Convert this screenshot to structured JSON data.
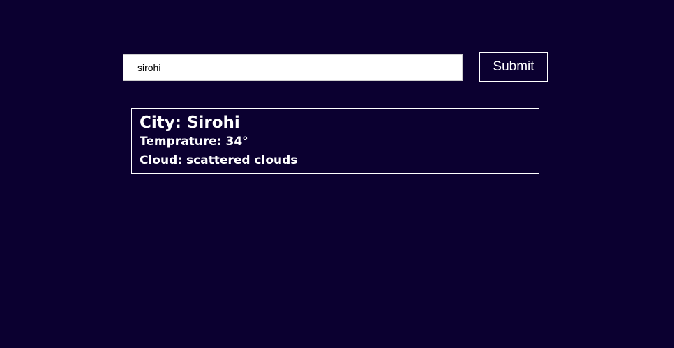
{
  "search": {
    "value": "sirohi",
    "submit_label": "Submit"
  },
  "weather": {
    "city_label": "City:",
    "city_value": "Sirohi",
    "temperature_label": "Temprature:",
    "temperature_value": "34°",
    "cloud_label": "Cloud:",
    "cloud_value": "scattered clouds"
  },
  "colors": {
    "background": "#0b0030",
    "text": "#ffffff",
    "input_background": "#ffffff"
  }
}
